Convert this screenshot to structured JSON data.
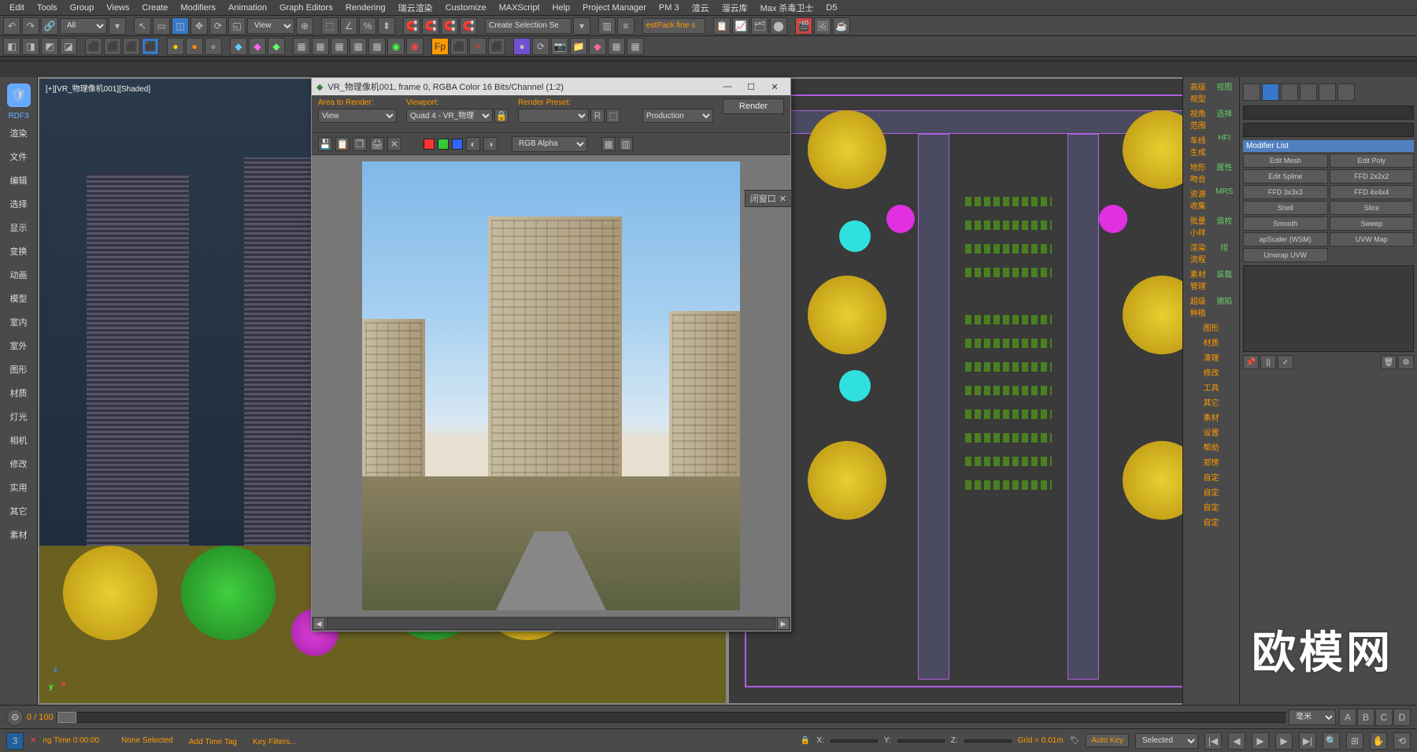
{
  "menu": [
    "Edit",
    "Tools",
    "Group",
    "Views",
    "Create",
    "Modifiers",
    "Animation",
    "Graph Editors",
    "Rendering",
    "瑞云渲染",
    "Customize",
    "MAXScript",
    "Help",
    "Project Manager",
    "PM 3",
    "渲云",
    "溜云库",
    "Max 杀毒卫士",
    "D5"
  ],
  "toolbar1": {
    "sel": "All",
    "view": "View",
    "search": "Create Selection Se",
    "est": "estPack fine s"
  },
  "left": {
    "label": "RDF3",
    "items": [
      "渲染",
      "文件",
      "编辑",
      "选择",
      "显示",
      "变换",
      "动画",
      "模型",
      "室内",
      "室外",
      "图形",
      "材质",
      "灯光",
      "相机",
      "修改",
      "实用",
      "其它",
      "素材"
    ]
  },
  "vp_label": "[+][VR_物理像机001][Shaded]",
  "right_strip": [
    [
      "高级视型",
      "视图"
    ],
    [
      "视角范围",
      "选择"
    ],
    [
      "车线生成",
      "HFI"
    ],
    [
      "地形吻合",
      "属性"
    ],
    [
      "资源收集",
      "MRS"
    ],
    [
      "批量小样",
      "值枚"
    ],
    [
      "渲染流程",
      "组"
    ],
    [
      "素材管理",
      "装载"
    ],
    [
      "超级种植",
      "摘陷"
    ],
    [
      "图形",
      ""
    ],
    [
      "材质",
      ""
    ],
    [
      "清理",
      ""
    ],
    [
      "修改",
      ""
    ],
    [
      "工具",
      ""
    ],
    [
      "其它",
      ""
    ],
    [
      "素材",
      ""
    ],
    [
      "设置",
      ""
    ],
    [
      "帮助",
      ""
    ],
    [
      "郑愣",
      ""
    ],
    [
      "自定",
      ""
    ],
    [
      "自定",
      ""
    ],
    [
      "自定",
      ""
    ],
    [
      "自定",
      ""
    ]
  ],
  "mod_list_label": "Modifier List",
  "modifiers": [
    "Edit Mesh",
    "Edit Poly",
    "Edit Spline",
    "FFD 2x2x2",
    "FFD 3x3x3",
    "FFD 4x4x4",
    "Shell",
    "Slice",
    "Smooth",
    "Sweep",
    "apScaler (WSM)",
    "UVW Map",
    "Unwrap UVW"
  ],
  "render": {
    "title": "VR_物理像机001, frame 0, RGBA Color 16 Bits/Channel (1:2)",
    "area_label": "Area to Render:",
    "area": "View",
    "viewport_label": "Viewport:",
    "viewport": "Quad 4 - VR_物理",
    "preset_label": "Render Preset:",
    "preset": "",
    "production": "Production",
    "render_btn": "Render",
    "channel": "RGB Alpha",
    "close_label": "闭窗口"
  },
  "timeline": {
    "range": "0 / 100",
    "units": "毫米"
  },
  "status": {
    "sel": "None Selected",
    "x": "X:",
    "y": "Y:",
    "z": "Z:",
    "grid": "Grid = 0.01m",
    "autokey": "Auto Key",
    "selected": "Selected",
    "addtag": "Add Time Tag",
    "keyf": "Key Filters...",
    "rtime": "ng Time  0:00:00"
  },
  "watermark": "欧模网"
}
